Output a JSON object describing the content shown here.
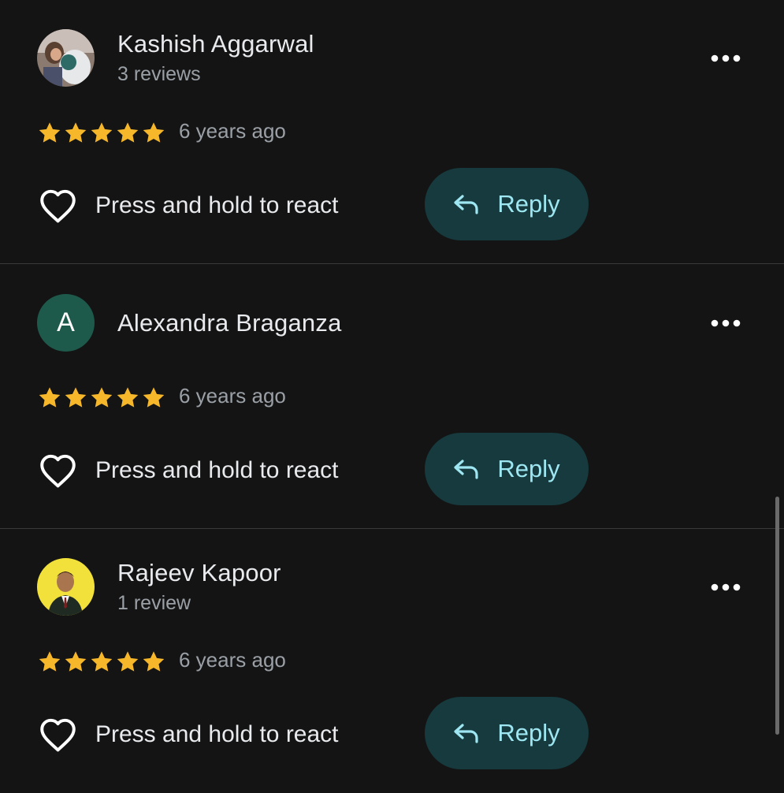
{
  "colors": {
    "background": "#141414",
    "star": "#f6b72b",
    "reply_button_bg": "#163a3d",
    "reply_text": "#9ee7f2",
    "secondary_text": "#9aa0a6",
    "avatar_letter_bg": "#1e5a4c"
  },
  "reviews": [
    {
      "author": "Kashish Aggarwal",
      "review_count": "3 reviews",
      "avatar": "photo",
      "rating": 5,
      "age": "6 years ago",
      "react_label": "Press and hold to react",
      "reply_label": "Reply"
    },
    {
      "author": "Alexandra Braganza",
      "review_count": "",
      "avatar": "letter",
      "avatar_letter": "A",
      "rating": 5,
      "age": "6 years ago",
      "react_label": "Press and hold to react",
      "reply_label": "Reply"
    },
    {
      "author": "Rajeev Kapoor",
      "review_count": "1 review",
      "avatar": "photo",
      "rating": 5,
      "age": "6 years ago",
      "react_label": "Press and hold to react",
      "reply_label": "Reply"
    }
  ],
  "icons": {
    "more": "more-horizontal-icon",
    "star": "star-icon",
    "heart": "heart-outline-icon",
    "reply": "reply-arrow-icon"
  }
}
